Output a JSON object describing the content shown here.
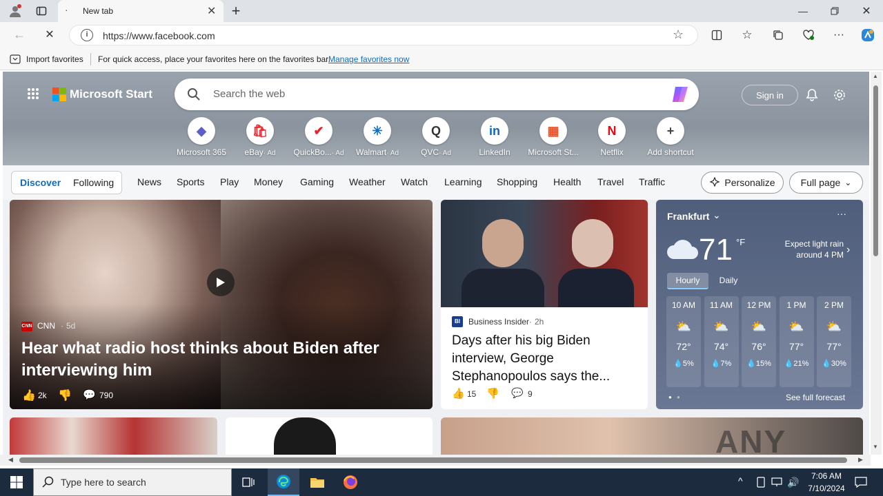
{
  "browser": {
    "tab_title": "New tab",
    "url": "https://www.facebook.com",
    "favbar": {
      "import_label": "Import favorites",
      "hint": "For quick access, place your favorites here on the favorites bar.",
      "manage_link": "Manage favorites now"
    }
  },
  "msn": {
    "logo_text": "Microsoft Start",
    "search_placeholder": "Search the web",
    "sign_in": "Sign in",
    "shortcuts": [
      {
        "label": "Microsoft 365",
        "ad": "",
        "glyph": "◆",
        "color": "#5b5fc7"
      },
      {
        "label": "eBay",
        "ad": "· Ad",
        "glyph": "🛍",
        "color": "#e53238"
      },
      {
        "label": "QuickBo...",
        "ad": "· Ad",
        "glyph": "✔",
        "color": "#e8222b"
      },
      {
        "label": "Walmart",
        "ad": "· Ad",
        "glyph": "✳",
        "color": "#0071ce"
      },
      {
        "label": "QVC",
        "ad": "· Ad",
        "glyph": "Q",
        "color": "#333333"
      },
      {
        "label": "LinkedIn",
        "ad": "",
        "glyph": "in",
        "color": "#0a66c2"
      },
      {
        "label": "Microsoft St...",
        "ad": "",
        "glyph": "▦",
        "color": "#f25022"
      },
      {
        "label": "Netflix",
        "ad": "",
        "glyph": "N",
        "color": "#e50914"
      },
      {
        "label": "Add shortcut",
        "ad": "",
        "glyph": "+",
        "color": "#444444"
      }
    ],
    "segment": {
      "discover": "Discover",
      "following": "Following"
    },
    "categories": [
      "News",
      "Sports",
      "Play",
      "Money",
      "Gaming",
      "Weather",
      "Watch",
      "Learning",
      "Shopping",
      "Health",
      "Travel",
      "Traffic"
    ],
    "personalize": "Personalize",
    "full_page": "Full page"
  },
  "feed": {
    "main": {
      "source": "CNN",
      "age": "5d",
      "headline": "Hear what radio host thinks about Biden after interviewing him",
      "likes": "2k",
      "comments": "790"
    },
    "side": {
      "source": "Business Insider",
      "age": "2h",
      "headline": "Days after his big Biden interview, George Stephanopoulos says the...",
      "likes": "15",
      "comments": "9"
    }
  },
  "weather": {
    "city": "Frankfurt",
    "temp": "71",
    "unit": "°F",
    "summary": "Expect light rain around 4 PM",
    "tabs": [
      "Hourly",
      "Daily"
    ],
    "hours": [
      {
        "time": "10 AM",
        "temp": "72°",
        "rain": "5%"
      },
      {
        "time": "11 AM",
        "temp": "74°",
        "rain": "7%"
      },
      {
        "time": "12 PM",
        "temp": "76°",
        "rain": "15%"
      },
      {
        "time": "1 PM",
        "temp": "77°",
        "rain": "21%"
      },
      {
        "time": "2 PM",
        "temp": "77°",
        "rain": "30%"
      }
    ],
    "see_full": "See full forecast"
  },
  "watermark": "ANY RUN",
  "taskbar": {
    "search_placeholder": "Type here to search",
    "time": "7:06 AM",
    "date": "7/10/2024"
  },
  "colors": {
    "accent": "#0f6cbd",
    "taskbar": "#1c2b3e",
    "weather_bg": "#5b6a86"
  }
}
